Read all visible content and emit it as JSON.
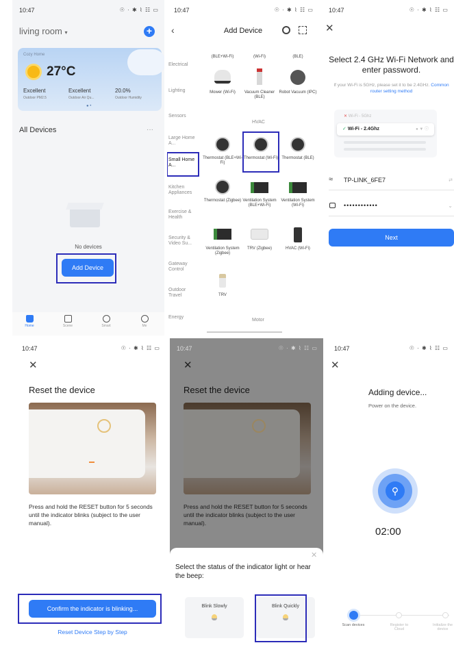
{
  "p1": {
    "time": "10:47",
    "status_icons": "☉ · ✱ ⌇ ☷ ▭",
    "room": "living room",
    "add_icon": "plus-icon",
    "weather": {
      "header": "Cozy Home",
      "temp": "27°C",
      "m1_v": "Excellent",
      "m1_l": "Outdoor PM2.5",
      "m2_v": "Excellent",
      "m2_l": "Outdoor Air Qu...",
      "m3_v": "20.0%",
      "m3_l": "Outdoor Humidity"
    },
    "all_devices": "All Devices",
    "more": "···",
    "no_devices": "No devices",
    "add_device": "Add Device",
    "nav": [
      "Home",
      "Scene",
      "Smart",
      "Me"
    ]
  },
  "p2": {
    "time": "10:47",
    "title": "Add Device",
    "categories": [
      "Electrical",
      "Lighting",
      "Sensors",
      "Large Home A...",
      "Small Home A...",
      "Kitchen Appliances",
      "Exercise & Health",
      "Security & Video Su...",
      "Gateway Control",
      "Outdoor Travel",
      "Energy"
    ],
    "top_caps": [
      "(BLE+Wi-Fi)",
      "(Wi-Fi)",
      "(BLE)"
    ],
    "devices_row1": [
      "Mower (Wi-Fi)",
      "Vacuum Cleaner (BLE)",
      "Robot Vacuum (IPC)"
    ],
    "hvac": "HVAC",
    "devices_row2": [
      "Thermostat (BLE+Wi-Fi)",
      "Thermostat (Wi-Fi)",
      "Thermostat (BLE)"
    ],
    "devices_row3": [
      "Thermostat (Zigbee)",
      "Ventilation System (BLE+Wi-Fi)",
      "Ventilation System (Wi-Fi)"
    ],
    "devices_row4": [
      "Ventilation System (Zigbee)",
      "TRV (Zigbee)",
      "HVAC (Wi-Fi)"
    ],
    "trv": "TRV",
    "motor": "Motor"
  },
  "p3": {
    "time": "10:47",
    "title": "Select 2.4 GHz Wi-Fi Network and enter password.",
    "hint": "If your Wi-Fi is 5GHz, please set it to be 2.4GHz.",
    "hint_link": "Common router setting method",
    "wifi_5g": "Wi-Fi - 5Ghz",
    "wifi_24g": "Wi-Fi - 2.4Ghz",
    "ssid": "TP-LINK_6FE7",
    "password": "••••••••••••",
    "next": "Next"
  },
  "p4": {
    "time": "10:47",
    "title": "Reset the device",
    "instructions": "Press and hold the RESET button for 5 seconds until the indicator blinks (subject to the user manual).",
    "confirm": "Confirm the indicator is blinking...",
    "step_link": "Reset Device Step by Step"
  },
  "p5": {
    "time": "10:47",
    "title": "Reset the device",
    "instructions": "Press and hold the RESET button for 5 seconds until the indicator blinks (subject to the user manual).",
    "sheet_title": "Select the status of the indicator light or hear the beep:",
    "blink_slowly": "Blink Slowly",
    "blink_quickly": "Blink Quickly"
  },
  "p6": {
    "time": "10:47",
    "title": "Adding device...",
    "subtitle": "Power on the device.",
    "timer": "02:00",
    "steps": [
      "Scan devices",
      "Register to Cloud",
      "Initialize the device"
    ]
  }
}
